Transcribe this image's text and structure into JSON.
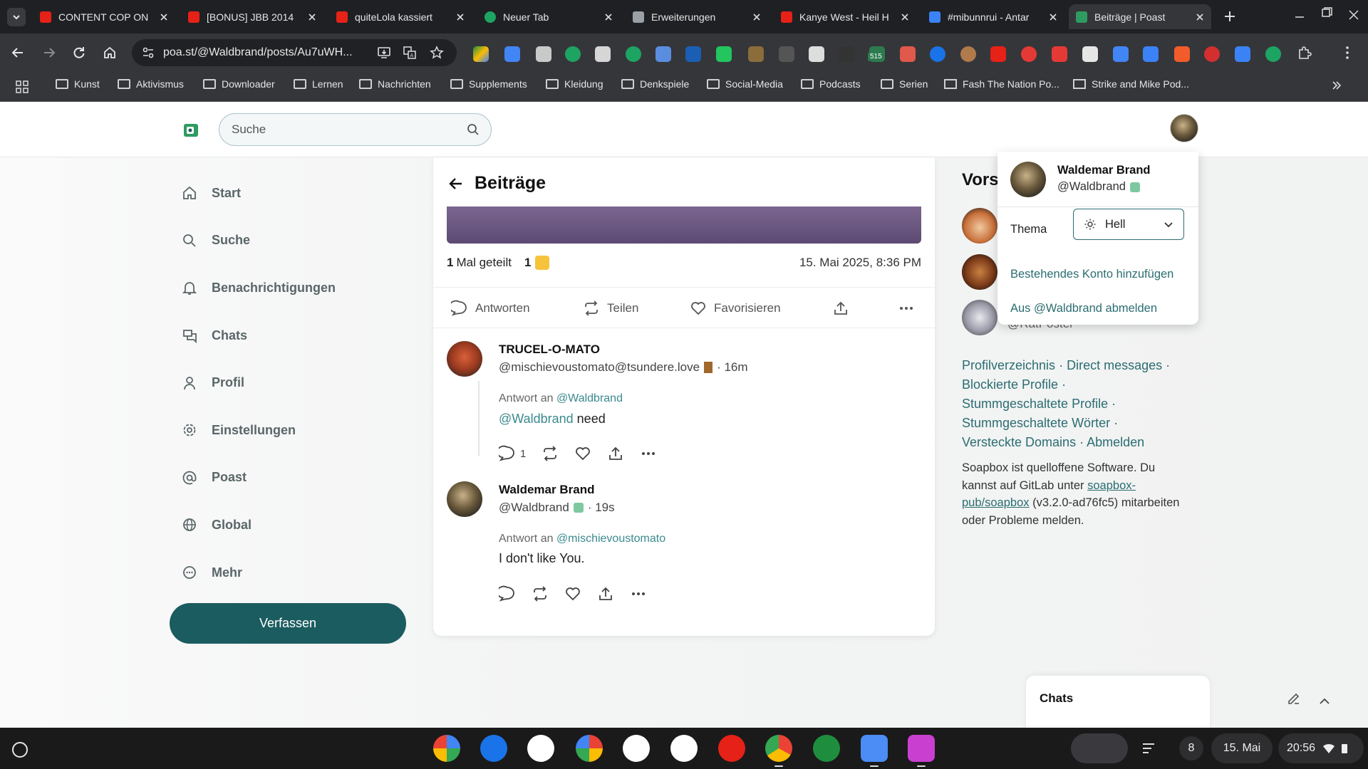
{
  "browser": {
    "tabs": [
      {
        "title": "CONTENT COP ON",
        "favicon_color": "#e62117",
        "active": false
      },
      {
        "title": "[BONUS] JBB 2014",
        "favicon_color": "#e62117",
        "active": false
      },
      {
        "title": "quiteLola kassiert",
        "favicon_color": "#e62117",
        "active": false
      },
      {
        "title": "Neuer Tab",
        "favicon_color": "#1da462",
        "active": false
      },
      {
        "title": "Erweiterungen",
        "favicon_color": "#9aa0a6",
        "active": false
      },
      {
        "title": "Kanye West - Heil H",
        "favicon_color": "#e62117",
        "active": false
      },
      {
        "title": "#mibunnrui - Antar",
        "favicon_color": "#3b82f6",
        "active": false
      },
      {
        "title": "Beiträge | Poast",
        "favicon_color": "#2e9b60",
        "active": true
      }
    ],
    "url": "poa.st/@Waldbrand/posts/Au7uWH...",
    "extension_badge": "515",
    "bookmarks": [
      {
        "label": "Kunst",
        "type": "folder"
      },
      {
        "label": "Aktivismus",
        "type": "folder"
      },
      {
        "label": "Downloader",
        "type": "folder"
      },
      {
        "label": "Lernen",
        "type": "folder"
      },
      {
        "label": "Nachrichten",
        "type": "folder"
      },
      {
        "label": "Supplements",
        "type": "folder"
      },
      {
        "label": "Kleidung",
        "type": "folder"
      },
      {
        "label": "Denkspiele",
        "type": "folder"
      },
      {
        "label": "Social-Media",
        "type": "folder"
      },
      {
        "label": "Podcasts",
        "type": "folder"
      },
      {
        "label": "Serien",
        "type": "folder"
      },
      {
        "label": "Fash The Nation Po...",
        "type": "page"
      },
      {
        "label": "Strike and Mike Pod...",
        "type": "page"
      }
    ]
  },
  "app": {
    "search_placeholder": "Suche",
    "nav": [
      {
        "label": "Start",
        "icon": "home-icon"
      },
      {
        "label": "Suche",
        "icon": "search-icon"
      },
      {
        "label": "Benachrichtigungen",
        "icon": "bell-icon"
      },
      {
        "label": "Chats",
        "icon": "chat-icon"
      },
      {
        "label": "Profil",
        "icon": "user-icon"
      },
      {
        "label": "Einstellungen",
        "icon": "gear-icon"
      },
      {
        "label": "Poast",
        "icon": "at-icon"
      },
      {
        "label": "Global",
        "icon": "globe-icon"
      },
      {
        "label": "Mehr",
        "icon": "more-icon"
      }
    ],
    "compose_label": "Verfassen",
    "accent_color": "#1b5c60",
    "link_color": "#2b6d72"
  },
  "post": {
    "header": "Beiträge",
    "shares_count": "1",
    "shares_label": "Mal geteilt",
    "likes_count": "1",
    "date": "15. Mai 2025, 8:36 PM",
    "actions": {
      "reply": "Antworten",
      "share": "Teilen",
      "favorite": "Favorisieren"
    }
  },
  "replies": [
    {
      "name": "TRUCEL-O-MATO",
      "handle": "@mischievoustomato@tsundere.love",
      "time": "· 16m",
      "reply_to_prefix": "Antwort an",
      "reply_to": "@Waldbrand",
      "body_mention": "@Waldbrand",
      "body": "need",
      "reply_count": "1"
    },
    {
      "name": "Waldemar Brand",
      "handle": "@Waldbrand",
      "time": "· 19s",
      "reply_to_prefix": "Antwort an",
      "reply_to": "@mischievoustomato",
      "body": "I don't like You."
    }
  ],
  "sidebar": {
    "suggestions_title_partial": "Vors",
    "partial_handle": "@RatPoster",
    "links": [
      "Profilverzeichnis",
      "Direct messages",
      "Blockierte Profile",
      "Stummgeschaltete Profile",
      "Stummgeschaltete Wörter",
      "Versteckte Domains",
      "Abmelden"
    ],
    "about_text_1": "Soapbox ist quelloffene Software. Du kannst auf GitLab unter",
    "about_link": "soapbox-pub/soapbox",
    "about_text_2": "(v3.2.0-ad76fc5) mitarbeiten oder Probleme melden."
  },
  "account_menu": {
    "name": "Waldemar Brand",
    "handle": "@Waldbrand",
    "theme_label": "Thema",
    "theme_value": "Hell",
    "add_account": "Bestehendes Konto hinzufügen",
    "logout": "Aus @Waldbrand abmelden"
  },
  "chats_widget": {
    "title": "Chats"
  },
  "shelf": {
    "notification_count": "8",
    "date": "15. Mai",
    "time": "20:56"
  }
}
